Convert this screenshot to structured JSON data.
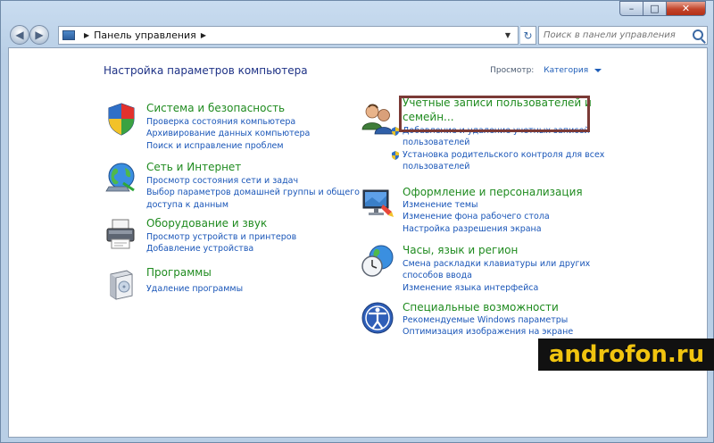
{
  "window": {
    "caption": {
      "minimize": "–",
      "maximize": "□",
      "close": "✕"
    }
  },
  "toolbar": {
    "back_label": "◀",
    "forward_label": "▶",
    "address_arrow": "▶",
    "address_text": "Панель управления",
    "address_arrow_after": "▶",
    "dropdown": "▼",
    "refresh": "↻",
    "search_placeholder": "Поиск в панели управления"
  },
  "main": {
    "heading": "Настройка параметров компьютера",
    "view_label": "Просмотр:",
    "view_value": "Категория"
  },
  "categories_left": [
    {
      "icon": "security-shield-icon",
      "title": "Система и безопасность",
      "links": [
        "Проверка состояния компьютера",
        "Архивирование данных компьютера",
        "Поиск и исправление проблем"
      ]
    },
    {
      "icon": "network-globe-icon",
      "title": "Сеть и Интернет",
      "links": [
        "Просмотр состояния сети и задач",
        "Выбор параметров домашней группы и общего",
        "доступа к данным"
      ]
    },
    {
      "icon": "printer-icon",
      "title": "Оборудование и звук",
      "links": [
        "Просмотр устройств и принтеров",
        "Добавление устройства"
      ]
    },
    {
      "icon": "programs-box-icon",
      "title": "Программы",
      "links": [
        "Удаление программы"
      ]
    }
  ],
  "categories_right": [
    {
      "icon": "users-icon",
      "title_line1": "Учетные записи пользователей и",
      "title_line2": "семейн...",
      "links": [
        "Добавление и удаление учетных записей",
        "пользователей",
        "Установка родительского контроля для всех",
        "пользователей"
      ]
    },
    {
      "icon": "appearance-monitor-icon",
      "title": "Оформление и персонализация",
      "links": [
        "Изменение темы",
        "Изменение фона рабочего стола",
        "Настройка разрешения экрана"
      ]
    },
    {
      "icon": "clock-globe-icon",
      "title": "Часы, язык и регион",
      "links": [
        "Смена раскладки клавиатуры или других",
        "способов ввода",
        "Изменение языка интерфейса"
      ]
    },
    {
      "icon": "ease-of-access-icon",
      "title": "Специальные возможности",
      "links": [
        "Рекомендуемые Windows параметры",
        "Оптимизация изображения на экране"
      ]
    }
  ],
  "watermark": "androfon.ru"
}
